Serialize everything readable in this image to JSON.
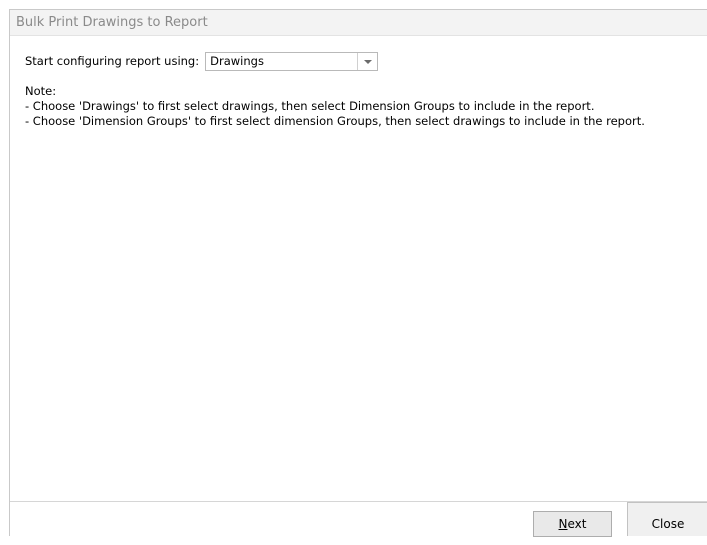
{
  "window": {
    "title": "Bulk Print Drawings to Report"
  },
  "config": {
    "label": "Start configuring report using:",
    "selected_option": "Drawings"
  },
  "notes": {
    "heading": "Note:",
    "line1": "- Choose 'Drawings' to first select drawings, then select Dimension Groups to include in the report.",
    "line2": "- Choose 'Dimension Groups' to first select dimension Groups, then select drawings to include in the report."
  },
  "buttons": {
    "next_mnemonic": "N",
    "next_rest": "ext",
    "close_label": "Close"
  }
}
